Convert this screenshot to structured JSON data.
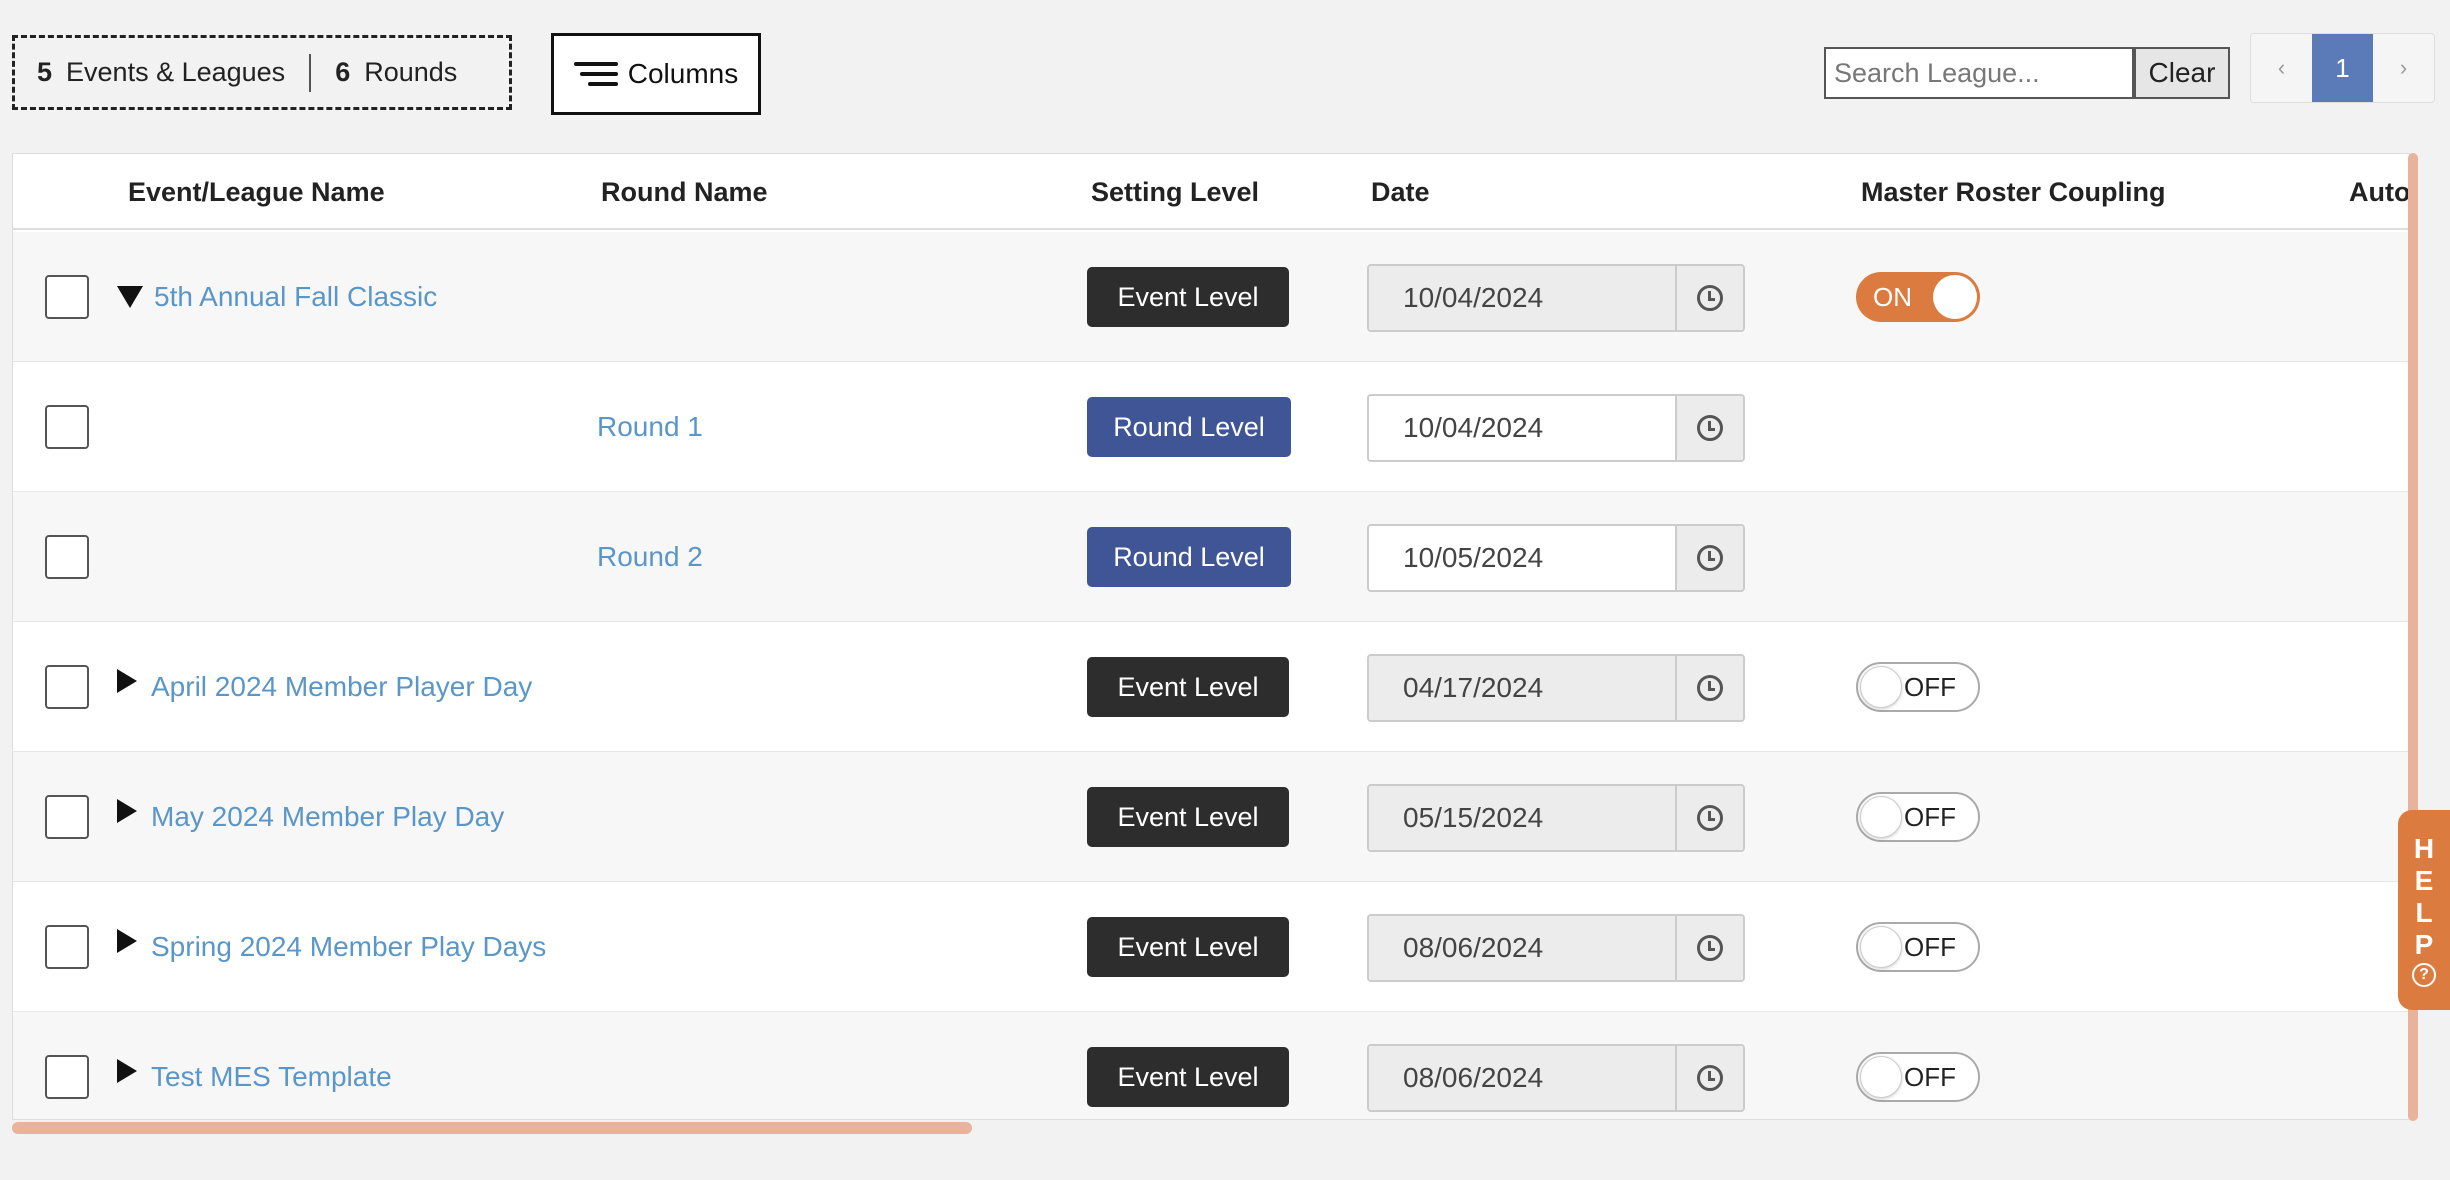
{
  "counts": {
    "events_num": "5",
    "events_label": "Events & Leagues",
    "rounds_num": "6",
    "rounds_label": "Rounds"
  },
  "toolbar": {
    "columns_label": "Columns",
    "search_placeholder": "Search League...",
    "clear_label": "Clear"
  },
  "pagination": {
    "prev": "‹",
    "current": "1",
    "next": "›"
  },
  "table": {
    "headers": {
      "name": "Event/League Name",
      "round": "Round Name",
      "level": "Setting Level",
      "date": "Date",
      "coupling": "Master Roster Coupling",
      "auto": "Auto"
    },
    "rows": [
      {
        "type": "event",
        "expanded": true,
        "name": "5th Annual Fall Classic",
        "round": "",
        "level": "Event Level",
        "date": "10/04/2024",
        "coupling": "ON"
      },
      {
        "type": "round",
        "name": "",
        "round": "Round 1",
        "level": "Round Level",
        "date": "10/04/2024",
        "coupling": ""
      },
      {
        "type": "round",
        "name": "",
        "round": "Round 2",
        "level": "Round Level",
        "date": "10/05/2024",
        "coupling": ""
      },
      {
        "type": "event",
        "expanded": false,
        "name": "April 2024 Member Player Day",
        "round": "",
        "level": "Event Level",
        "date": "04/17/2024",
        "coupling": "OFF"
      },
      {
        "type": "event",
        "expanded": false,
        "name": "May 2024 Member Play Day",
        "round": "",
        "level": "Event Level",
        "date": "05/15/2024",
        "coupling": "OFF"
      },
      {
        "type": "event",
        "expanded": false,
        "name": "Spring 2024 Member Play Days",
        "round": "",
        "level": "Event Level",
        "date": "08/06/2024",
        "coupling": "OFF"
      },
      {
        "type": "event",
        "expanded": false,
        "name": "Test MES Template",
        "round": "",
        "level": "Event Level",
        "date": "08/06/2024",
        "coupling": "OFF"
      }
    ]
  },
  "help": {
    "letters": [
      "H",
      "E",
      "L",
      "P"
    ],
    "icon": "question-circle-icon"
  },
  "colors": {
    "link": "#5b96c8",
    "accent": "#dc7b3f",
    "event_level": "#2d2d2d",
    "round_level": "#3f5596",
    "page_active": "#5b7ab8"
  }
}
